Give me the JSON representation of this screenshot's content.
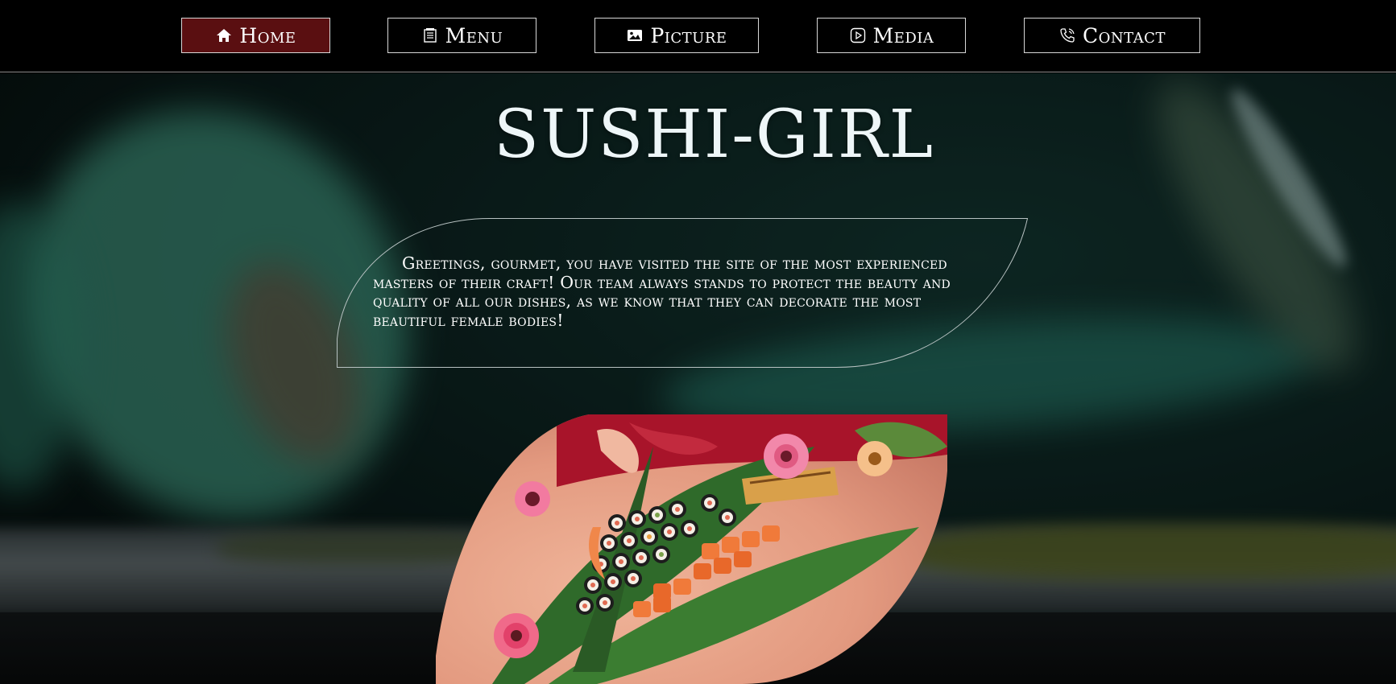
{
  "nav": {
    "items": [
      {
        "id": "home",
        "label": "Home",
        "icon": "home-icon",
        "active": true
      },
      {
        "id": "menu",
        "label": "Menu",
        "icon": "menu-icon",
        "active": false
      },
      {
        "id": "picture",
        "label": "Picture",
        "icon": "picture-icon",
        "active": false
      },
      {
        "id": "media",
        "label": "Media",
        "icon": "media-icon",
        "active": false
      },
      {
        "id": "contact",
        "label": "Contact",
        "icon": "phone-icon",
        "active": false
      }
    ]
  },
  "hero": {
    "title": "SUSHI-GIRL",
    "greeting": "Greetings, gourmet, you have visited the site of the most experienced masters of their craft! Our team always stands to protect the beauty and quality of all our dishes, as we know that they can decorate the most beautiful female bodies!"
  },
  "colors": {
    "nav_background": "#000000",
    "active_button": "#5a0f11",
    "button_border": "#d8d8d8",
    "title_color": "#eef6f8",
    "background_teal": "#0b1f1d"
  }
}
